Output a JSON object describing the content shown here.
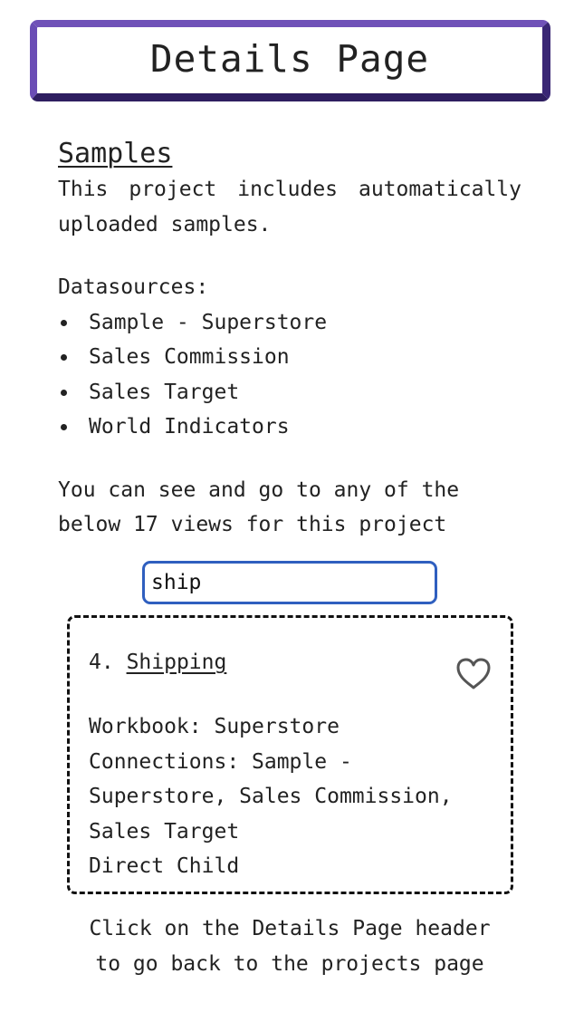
{
  "header": {
    "title": "Details Page"
  },
  "section": {
    "title": "Samples",
    "description": "This project includes automatically uploaded samples."
  },
  "datasources": {
    "label": "Datasources:",
    "items": [
      "Sample - Superstore",
      "Sales Commission",
      "Sales Target",
      "World Indicators"
    ]
  },
  "views_text": "You can see and go to any of the below 17 views for this project",
  "search": {
    "value": "ship",
    "placeholder": ""
  },
  "results": [
    {
      "index": "4.",
      "name": "Shipping",
      "workbook": "Workbook: Superstore",
      "connections": "Connections: Sample - Superstore, Sales Commission, Sales Target",
      "relation": "Direct Child",
      "icon": "heart-outline-icon"
    }
  ],
  "footer_note": "Click on the Details Page header to go back to the projects page",
  "colors": {
    "header_border": "#6a4db5",
    "header_border_dark": "#2e1e60",
    "search_border": "#2f5fbf",
    "text": "#222222"
  }
}
